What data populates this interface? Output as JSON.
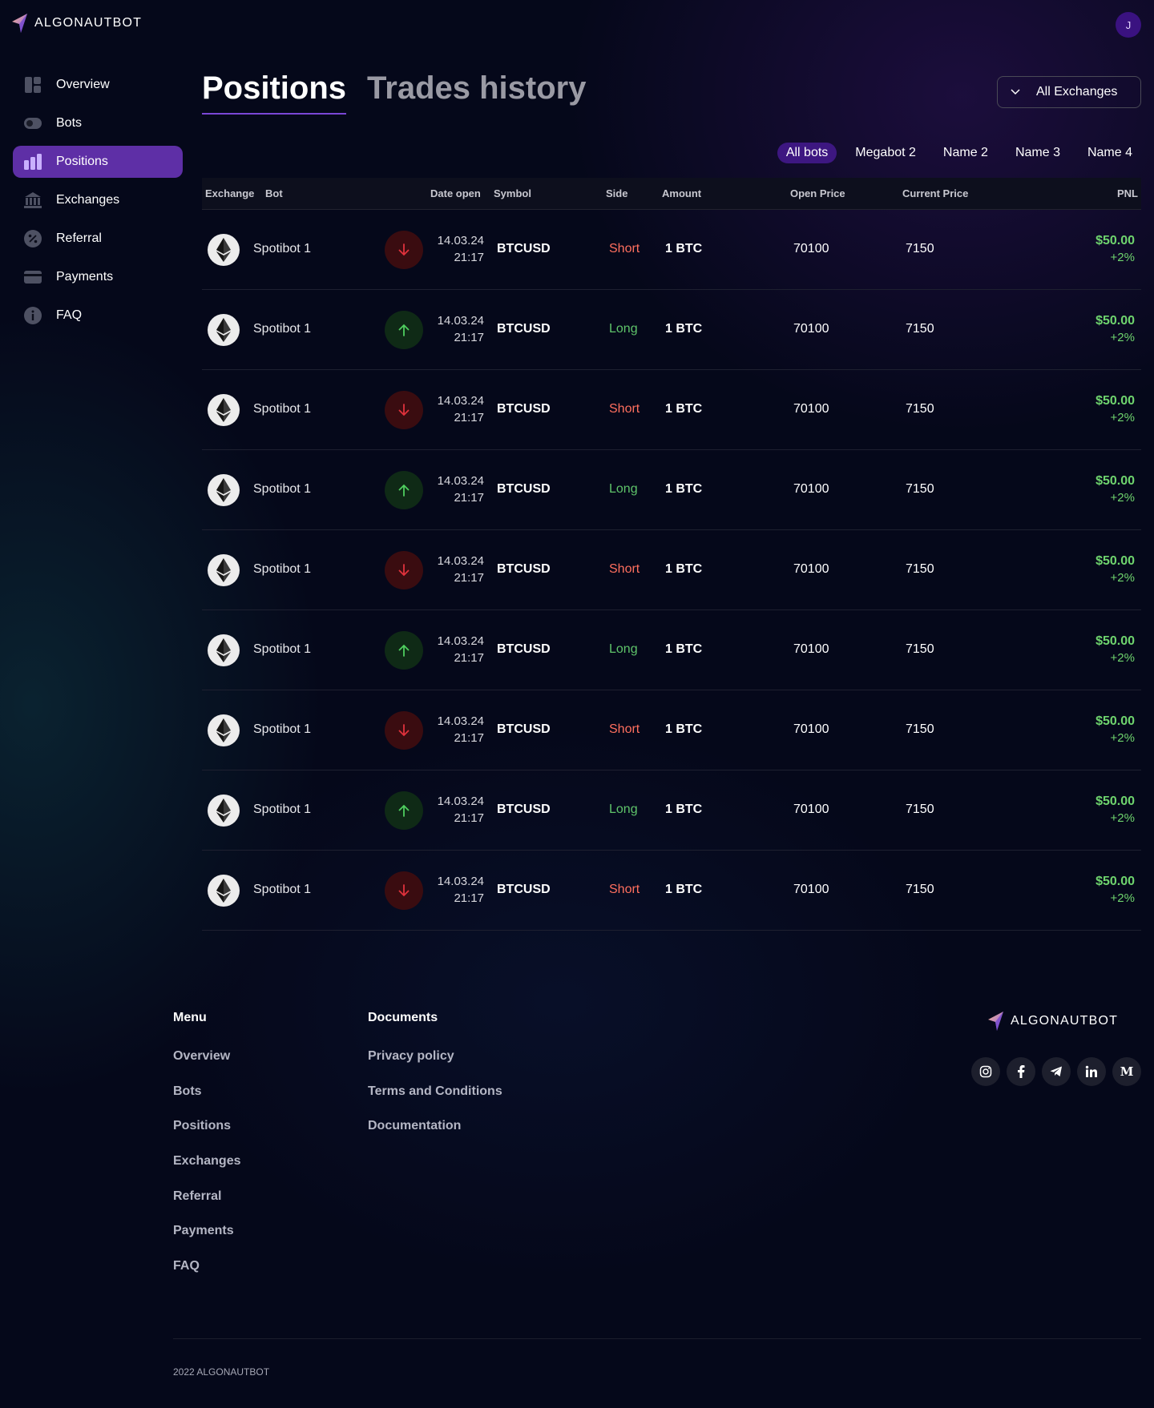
{
  "brand": {
    "name": "ALGONAUTBOT",
    "avatar_initial": "J"
  },
  "sidebar": {
    "items": [
      {
        "label": "Overview",
        "icon": "dashboard-icon"
      },
      {
        "label": "Bots",
        "icon": "toggle-icon"
      },
      {
        "label": "Positions",
        "icon": "bar-chart-icon",
        "active": true
      },
      {
        "label": "Exchanges",
        "icon": "bank-icon"
      },
      {
        "label": "Referral",
        "icon": "percent-icon"
      },
      {
        "label": "Payments",
        "icon": "card-icon"
      },
      {
        "label": "FAQ",
        "icon": "info-icon"
      }
    ]
  },
  "main": {
    "tabs": [
      {
        "label": "Positions",
        "active": true
      },
      {
        "label": "Trades history",
        "active": false
      }
    ],
    "exchange_select": {
      "value": "All Exchanges"
    },
    "bot_filters": [
      "All bots",
      "Megabot 2",
      "Name 2",
      "Name 3",
      "Name 4"
    ],
    "table": {
      "headers": {
        "exchange": "Exchange",
        "bot": "Bot",
        "date_open": "Date open",
        "symbol": "Symbol",
        "side": "Side",
        "amount": "Amount",
        "open_price": "Open Price",
        "current_price": "Current Price",
        "pnl": "PNL"
      },
      "rows": [
        {
          "bot": "Spotibot 1",
          "direction": "short",
          "date": "14.03.24",
          "time": "21:17",
          "symbol": "BTCUSD",
          "side": "Short",
          "amount": "1 BTC",
          "open_price": "70100",
          "current_price": "7150",
          "pnl": "$50.00",
          "pnl_pct": "+2%"
        },
        {
          "bot": "Spotibot 1",
          "direction": "long",
          "date": "14.03.24",
          "time": "21:17",
          "symbol": "BTCUSD",
          "side": "Long",
          "amount": "1 BTC",
          "open_price": "70100",
          "current_price": "7150",
          "pnl": "$50.00",
          "pnl_pct": "+2%"
        },
        {
          "bot": "Spotibot 1",
          "direction": "short",
          "date": "14.03.24",
          "time": "21:17",
          "symbol": "BTCUSD",
          "side": "Short",
          "amount": "1 BTC",
          "open_price": "70100",
          "current_price": "7150",
          "pnl": "$50.00",
          "pnl_pct": "+2%"
        },
        {
          "bot": "Spotibot 1",
          "direction": "long",
          "date": "14.03.24",
          "time": "21:17",
          "symbol": "BTCUSD",
          "side": "Long",
          "amount": "1 BTC",
          "open_price": "70100",
          "current_price": "7150",
          "pnl": "$50.00",
          "pnl_pct": "+2%"
        },
        {
          "bot": "Spotibot 1",
          "direction": "short",
          "date": "14.03.24",
          "time": "21:17",
          "symbol": "BTCUSD",
          "side": "Short",
          "amount": "1 BTC",
          "open_price": "70100",
          "current_price": "7150",
          "pnl": "$50.00",
          "pnl_pct": "+2%"
        },
        {
          "bot": "Spotibot 1",
          "direction": "long",
          "date": "14.03.24",
          "time": "21:17",
          "symbol": "BTCUSD",
          "side": "Long",
          "amount": "1 BTC",
          "open_price": "70100",
          "current_price": "7150",
          "pnl": "$50.00",
          "pnl_pct": "+2%"
        },
        {
          "bot": "Spotibot 1",
          "direction": "short",
          "date": "14.03.24",
          "time": "21:17",
          "symbol": "BTCUSD",
          "side": "Short",
          "amount": "1 BTC",
          "open_price": "70100",
          "current_price": "7150",
          "pnl": "$50.00",
          "pnl_pct": "+2%"
        },
        {
          "bot": "Spotibot 1",
          "direction": "long",
          "date": "14.03.24",
          "time": "21:17",
          "symbol": "BTCUSD",
          "side": "Long",
          "amount": "1 BTC",
          "open_price": "70100",
          "current_price": "7150",
          "pnl": "$50.00",
          "pnl_pct": "+2%"
        },
        {
          "bot": "Spotibot 1",
          "direction": "short",
          "date": "14.03.24",
          "time": "21:17",
          "symbol": "BTCUSD",
          "side": "Short",
          "amount": "1 BTC",
          "open_price": "70100",
          "current_price": "7150",
          "pnl": "$50.00",
          "pnl_pct": "+2%"
        }
      ]
    }
  },
  "footer": {
    "menu_title": "Menu",
    "menu_links": [
      "Overview",
      "Bots",
      "Positions",
      "Exchanges",
      "Referral",
      "Payments",
      "FAQ"
    ],
    "documents_title": "Documents",
    "documents_links": [
      "Privacy policy",
      "Terms and Conditions",
      "Documentation"
    ],
    "socials": [
      "instagram-icon",
      "facebook-icon",
      "telegram-icon",
      "linkedin-icon",
      "medium-icon"
    ],
    "copyright": "2022 ALGONAUTBOT"
  },
  "colors": {
    "background": "#05081a",
    "accent": "#5e2fa6",
    "short": "#ff6f5e",
    "long": "#5fc46a",
    "pnl_positive": "#6fd56e"
  }
}
